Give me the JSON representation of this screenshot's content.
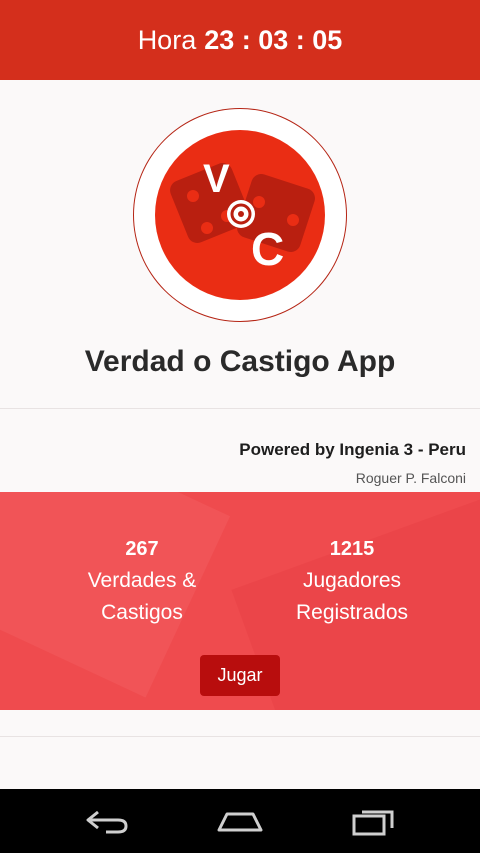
{
  "header": {
    "prefix": "Hora",
    "time": "23 : 03 : 05"
  },
  "logo": {
    "letters": [
      "V",
      "C"
    ],
    "colors": {
      "primary": "#ea2d14",
      "dice": "#b91f10"
    }
  },
  "app": {
    "title": "Verdad o Castigo App"
  },
  "credits": {
    "powered_by": "Powered by Ingenia 3 - Peru",
    "author": "Roguer P. Falconi"
  },
  "stats": {
    "truths": {
      "count": "267",
      "label_line1": "Verdades &",
      "label_line2": "Castigos"
    },
    "players": {
      "count": "1215",
      "label_line1": "Jugadores",
      "label_line2": "Registrados"
    }
  },
  "actions": {
    "play_label": "Jugar"
  },
  "nav": {
    "icons": [
      "back-icon",
      "home-icon",
      "recent-apps-icon"
    ]
  },
  "colors": {
    "header": "#d42f1c",
    "stats_bg": "#ef4b4e",
    "button": "#b80d0d"
  }
}
